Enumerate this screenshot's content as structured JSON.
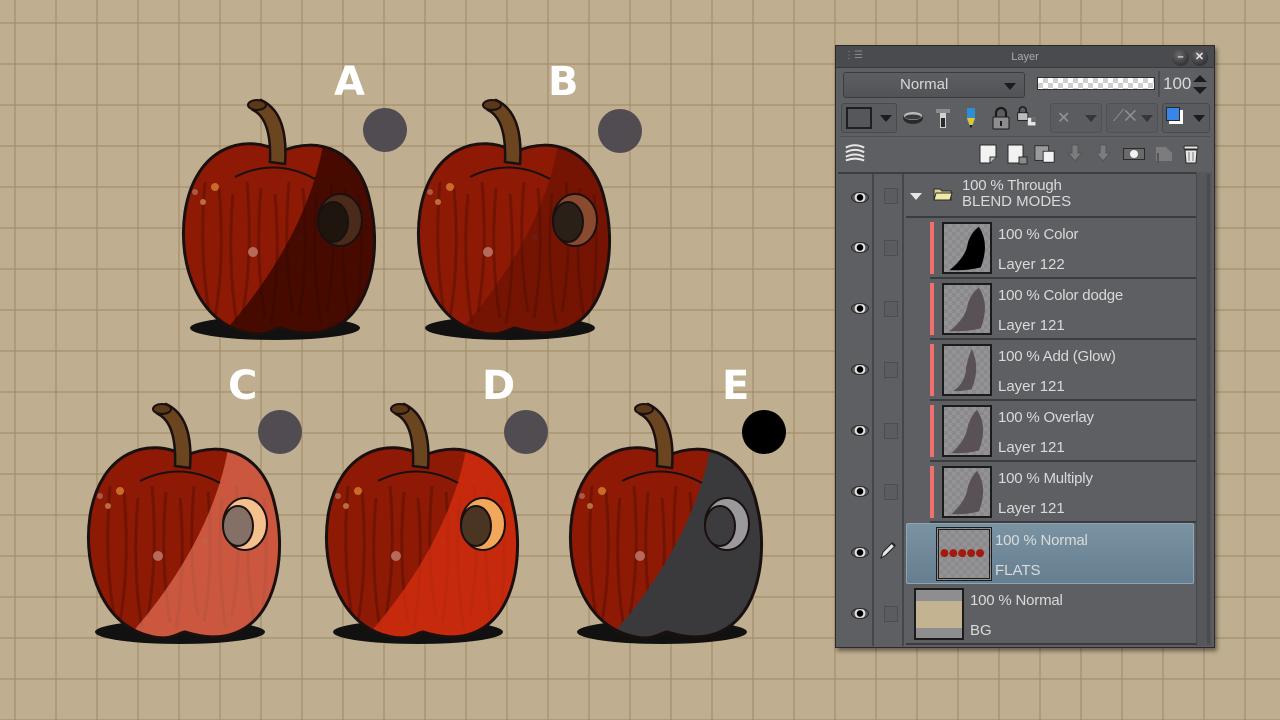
{
  "canvas": {
    "background_color": "#bfae8f",
    "examples": [
      {
        "label": "A",
        "swatch_color": "#514c52",
        "overlay_mode": "Multiply"
      },
      {
        "label": "B",
        "swatch_color": "#514c52",
        "overlay_mode": "Overlay"
      },
      {
        "label": "C",
        "swatch_color": "#514c52",
        "overlay_mode": "Add (Glow)"
      },
      {
        "label": "D",
        "swatch_color": "#514c52",
        "overlay_mode": "Color dodge"
      },
      {
        "label": "E",
        "swatch_color": "#000000",
        "overlay_mode": "Color"
      }
    ]
  },
  "panel": {
    "title": "Layer",
    "minimize_icon": "minimize-icon",
    "close_icon": "close-icon",
    "blend_mode": "Normal",
    "opacity": "100",
    "toolbar_row2": [
      "layer-color-icon",
      "clip-below-icon",
      "reference-layer-icon",
      "draft-layer-icon",
      "lock-icon",
      "lock-transparency-icon",
      "mask-enable-icon",
      "ruler-enable-icon",
      "layer-color-swatch-icon"
    ],
    "toolbar_row3": [
      "layer-stack-icon",
      "new-raster-layer-icon",
      "new-vector-layer-icon",
      "new-folder-icon",
      "transfer-down-icon",
      "merge-down-icon",
      "create-mask-icon",
      "apply-mask-icon",
      "delete-layer-icon"
    ],
    "layers": [
      {
        "mode_line": "100 % Through",
        "name": "BLEND MODES",
        "type": "folder",
        "visible": true,
        "expanded": true
      },
      {
        "mode_line": "100 % Color",
        "name": "Layer 122",
        "type": "raster",
        "visible": true,
        "clipped": true
      },
      {
        "mode_line": "100 % Color dodge",
        "name": "Layer 121",
        "type": "raster",
        "visible": true,
        "clipped": true
      },
      {
        "mode_line": "100 % Add (Glow)",
        "name": "Layer 121",
        "type": "raster",
        "visible": true,
        "clipped": true
      },
      {
        "mode_line": "100 % Overlay",
        "name": "Layer 121",
        "type": "raster",
        "visible": true,
        "clipped": true
      },
      {
        "mode_line": "100 % Multiply",
        "name": "Layer 121",
        "type": "raster",
        "visible": true,
        "clipped": true
      },
      {
        "mode_line": "100 % Normal",
        "name": "FLATS",
        "type": "raster",
        "visible": true,
        "selected": true,
        "editing": true
      },
      {
        "mode_line": "100 % Normal",
        "name": "BG",
        "type": "paper",
        "visible": true
      }
    ]
  }
}
